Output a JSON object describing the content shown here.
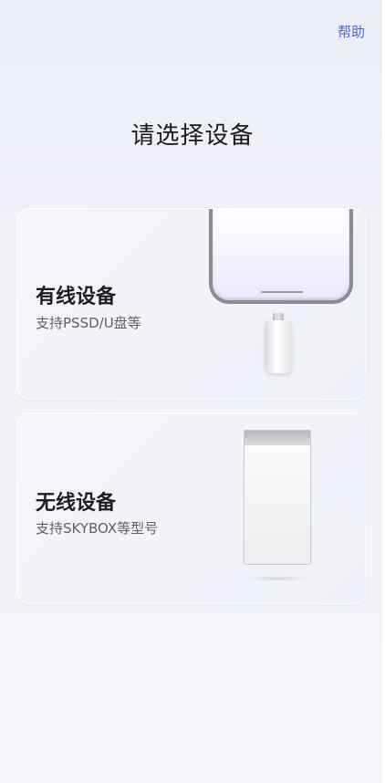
{
  "header": {
    "help_label": "帮助"
  },
  "page": {
    "title": "请选择设备"
  },
  "devices": [
    {
      "title": "有线设备",
      "subtitle": "支持PSSD/U盘等",
      "icon": "phone-usb-drive-icon"
    },
    {
      "title": "无线设备",
      "subtitle": "支持SKYBOX等型号",
      "icon": "skybox-device-icon"
    }
  ],
  "colors": {
    "accent": "#4468e0",
    "background": "#f2f3f9",
    "card": "#f1f2f8"
  }
}
